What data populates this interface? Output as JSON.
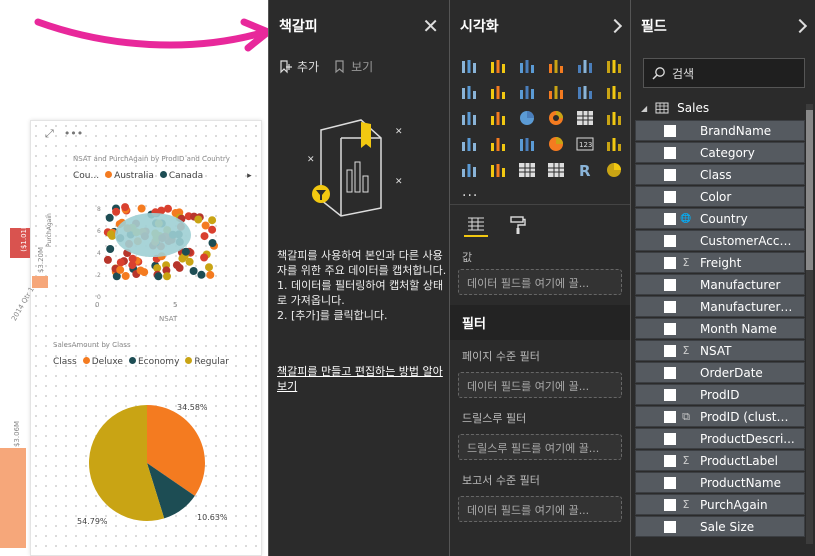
{
  "canvas": {
    "scatter_title": "NSAT and PurchAgain by ProdID and Country",
    "scatter_legend_label": "Cou...",
    "scatter_legend": [
      {
        "name": "Australia",
        "color": "#f47b20"
      },
      {
        "name": "Canada",
        "color": "#1d4d54"
      }
    ],
    "scatter_yaxis": "PurchAgain",
    "scatter_xaxis": "NSAT",
    "scatter_yticks": [
      "8",
      "6",
      "4",
      "2",
      "0"
    ],
    "scatter_xticks": [
      "0",
      "5"
    ],
    "side_labels": [
      "($1.01M)",
      "$3.20M",
      "2014 Qtr 1",
      "$3.06M"
    ],
    "pie_title": "SalesAmount by Class",
    "pie_legend_label": "Class",
    "pie_legend": [
      {
        "name": "Deluxe",
        "color": "#f47b20"
      },
      {
        "name": "Economy",
        "color": "#1d4d54"
      },
      {
        "name": "Regular",
        "color": "#c9a414"
      }
    ],
    "pie_labels": [
      "34.58%",
      "10.63%",
      "54.79%"
    ]
  },
  "bookmarks": {
    "title": "책갈피",
    "add_label": "추가",
    "view_label": "보기",
    "description": "책갈피를 사용하여 본인과 다른 사용자를 위한 주요 데이터를 캡처합니다.\n1. 데이터를 필터링하여 캡처할 상태로 가져옵니다.\n2. [추가]를 클릭합니다.",
    "learn_link": "책갈피를 만들고 편집하는 방법 알아보기"
  },
  "viz": {
    "title": "시각화",
    "more": "...",
    "values_label": "값",
    "values_drop": "데이터 필드를 여기에 끌...",
    "filters_header": "필터",
    "page_filter_label": "페이지 수준 필터",
    "page_filter_drop": "데이터 필드를 여기에 끌...",
    "drill_label": "드릴스루 필터",
    "drill_drop": "드릴스루 필드를 여기에 끌...",
    "report_filter_label": "보고서 수준 필터",
    "report_filter_drop": "데이터 필드를 여기에 끌..."
  },
  "fields": {
    "title": "필드",
    "search_placeholder": "검색",
    "table_name": "Sales",
    "items": [
      {
        "name": "BrandName",
        "type": ""
      },
      {
        "name": "Category",
        "type": ""
      },
      {
        "name": "Class",
        "type": ""
      },
      {
        "name": "Color",
        "type": ""
      },
      {
        "name": "Country",
        "type": "globe"
      },
      {
        "name": "CustomerAcco...",
        "type": ""
      },
      {
        "name": "Freight",
        "type": "sigma"
      },
      {
        "name": "Manufacturer",
        "type": ""
      },
      {
        "name": "Manufacturer ...",
        "type": ""
      },
      {
        "name": "Month Name",
        "type": ""
      },
      {
        "name": "NSAT",
        "type": "sigma"
      },
      {
        "name": "OrderDate",
        "type": ""
      },
      {
        "name": "ProdID",
        "type": ""
      },
      {
        "name": "ProdID (clusters)",
        "type": "cluster"
      },
      {
        "name": "ProductDescri...",
        "type": ""
      },
      {
        "name": "ProductLabel",
        "type": "sigma"
      },
      {
        "name": "ProductName",
        "type": ""
      },
      {
        "name": "PurchAgain",
        "type": "sigma"
      },
      {
        "name": "Sale Size",
        "type": ""
      }
    ]
  },
  "colors": {
    "panel_bg": "#2b2b2b",
    "field_bg": "#555a60",
    "accent_arrow": "#e8289b",
    "yellow": "#f2c811"
  }
}
